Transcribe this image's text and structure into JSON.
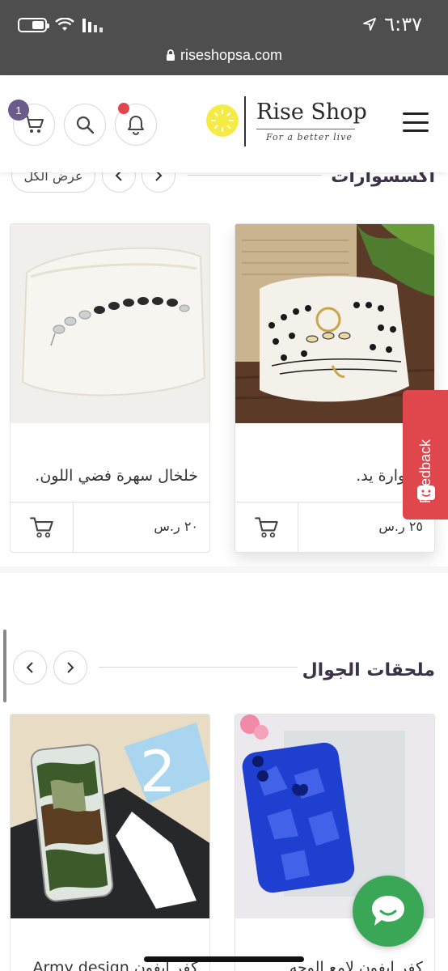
{
  "status_bar": {
    "time": "٦:٣٧",
    "url": "riseshopsa.com"
  },
  "header": {
    "logo_name": "Rise Shop",
    "logo_tagline": "For a better live",
    "cart_count": "1"
  },
  "sections": [
    {
      "title": "اكسسوارات",
      "view_all": "عرض الكل",
      "products": [
        {
          "title": "اسوارة يد.",
          "price": "٢٥ ر.س"
        },
        {
          "title": "خلخال سهرة فضي اللون.",
          "price": "٢٠ ر.س"
        }
      ]
    },
    {
      "title": "ملحقات الجوال",
      "products": [
        {
          "title": "كفر ايفون لامع الوجه"
        },
        {
          "title": "كفر ايفون Army design"
        }
      ]
    }
  ],
  "feedback_label": "Feedback",
  "colors": {
    "accent": "#6b5b8a",
    "feedback": "#e0474c",
    "chat": "#3aa757",
    "status_bar": "#4e4e4e"
  }
}
